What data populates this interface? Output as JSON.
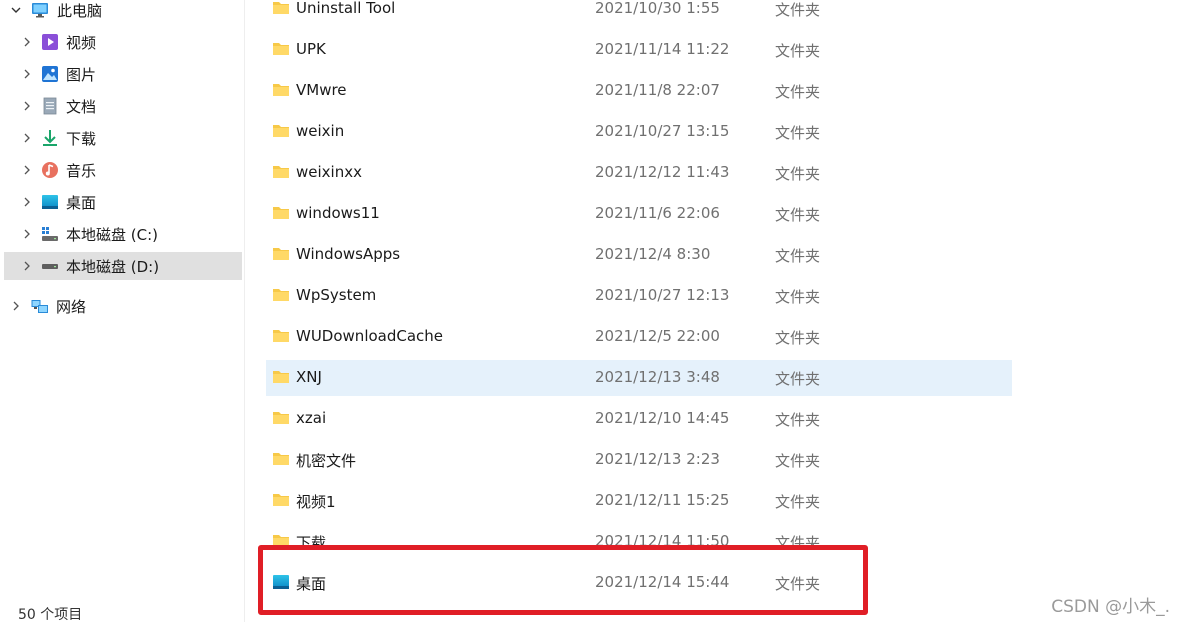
{
  "sidebar": {
    "items": [
      {
        "label": "此电脑",
        "icon": "computer-icon"
      },
      {
        "label": "视频",
        "icon": "video-icon"
      },
      {
        "label": "图片",
        "icon": "picture-icon"
      },
      {
        "label": "文档",
        "icon": "document-icon"
      },
      {
        "label": "下载",
        "icon": "download-icon"
      },
      {
        "label": "音乐",
        "icon": "music-icon"
      },
      {
        "label": "桌面",
        "icon": "desktop-icon"
      },
      {
        "label": "本地磁盘 (C:)",
        "icon": "drive-c-icon"
      },
      {
        "label": "本地磁盘 (D:)",
        "icon": "drive-d-icon"
      },
      {
        "label": "网络",
        "icon": "network-icon"
      }
    ],
    "selected": "本地磁盘 (D:)"
  },
  "status_bar": {
    "count": "50 个项目"
  },
  "files": [
    {
      "name": "Uninstall Tool",
      "date": "2021/10/30 1:55",
      "type": "文件夹"
    },
    {
      "name": "UPK",
      "date": "2021/11/14 11:22",
      "type": "文件夹"
    },
    {
      "name": "VMwre",
      "date": "2021/11/8 22:07",
      "type": "文件夹"
    },
    {
      "name": "weixin",
      "date": "2021/10/27 13:15",
      "type": "文件夹"
    },
    {
      "name": "weixinxx",
      "date": "2021/12/12 11:43",
      "type": "文件夹"
    },
    {
      "name": "windows11",
      "date": "2021/11/6 22:06",
      "type": "文件夹"
    },
    {
      "name": "WindowsApps",
      "date": "2021/12/4 8:30",
      "type": "文件夹"
    },
    {
      "name": "WpSystem",
      "date": "2021/10/27 12:13",
      "type": "文件夹"
    },
    {
      "name": "WUDownloadCache",
      "date": "2021/12/5 22:00",
      "type": "文件夹"
    },
    {
      "name": "XNJ",
      "date": "2021/12/13 3:48",
      "type": "文件夹"
    },
    {
      "name": "xzai",
      "date": "2021/12/10 14:45",
      "type": "文件夹"
    },
    {
      "name": "机密文件",
      "date": "2021/12/13 2:23",
      "type": "文件夹"
    },
    {
      "name": "视频1",
      "date": "2021/12/11 15:25",
      "type": "文件夹"
    },
    {
      "name": "下载",
      "date": "2021/12/14 11:50",
      "type": "文件夹"
    },
    {
      "name": "桌面",
      "date": "2021/12/14 15:44",
      "type": "文件夹"
    }
  ],
  "watermark": "CSDN @小木_.",
  "colors": {
    "selection": "#e0e0e0",
    "hover_row": "#e5f1fb",
    "folder": "#f7c948",
    "highlight_box": "#e01e26"
  }
}
